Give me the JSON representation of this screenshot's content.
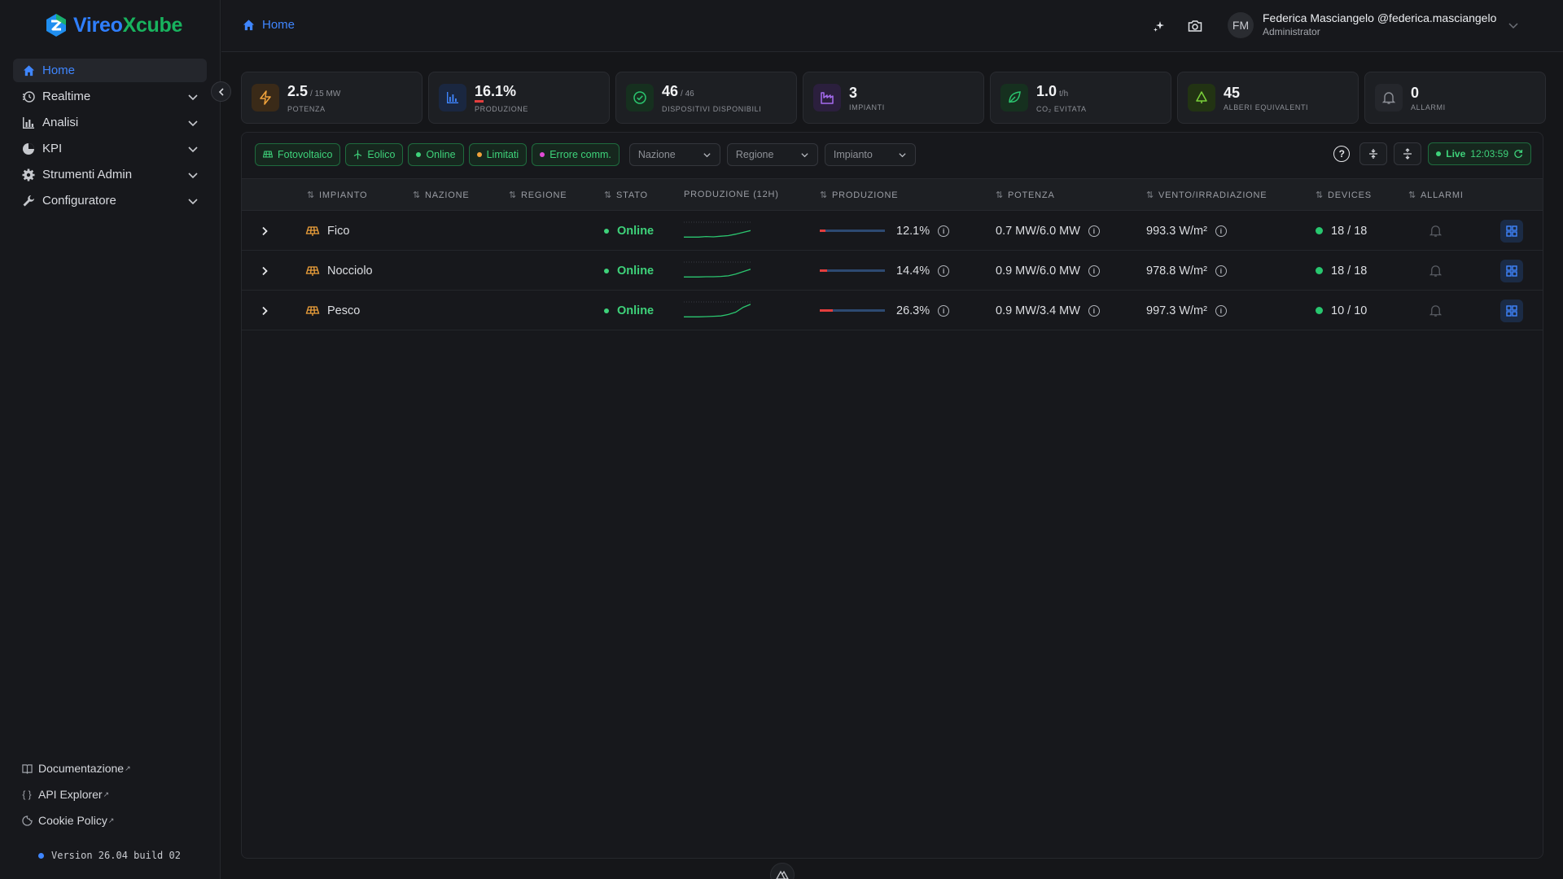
{
  "brand": {
    "part1": "Vireo",
    "part2": "Xcube"
  },
  "sidebar": {
    "items": [
      {
        "label": "Home",
        "icon": "home-icon",
        "active": true
      },
      {
        "label": "Realtime",
        "icon": "clock-icon"
      },
      {
        "label": "Analisi",
        "icon": "bar-chart-icon"
      },
      {
        "label": "KPI",
        "icon": "pie-chart-icon"
      },
      {
        "label": "Strumenti Admin",
        "icon": "gear-icon"
      },
      {
        "label": "Configuratore",
        "icon": "wrench-icon"
      }
    ],
    "links": [
      {
        "label": "Documentazione",
        "icon": "book-icon"
      },
      {
        "label": "API Explorer",
        "icon": "braces-icon"
      },
      {
        "label": "Cookie Policy",
        "icon": "cookie-icon"
      }
    ],
    "version": "Version 26.04 build 02"
  },
  "header": {
    "breadcrumb": "Home",
    "user": {
      "initials": "FM",
      "name": "Federica Masciangelo @federica.masciangelo",
      "role": "Administrator"
    }
  },
  "stats": [
    {
      "value": "2.5",
      "unit": "/ 15 MW",
      "label": "Potenza",
      "icon": "bolt-icon",
      "color": "#f0a23b"
    },
    {
      "value": "16.1%",
      "unit": "",
      "label": "Produzione",
      "icon": "bar-chart-icon",
      "color": "#3f86ff"
    },
    {
      "value": "46",
      "unit": "/ 46",
      "label": "Dispositivi disponibili",
      "icon": "check-circle-icon",
      "color": "#2bc56f"
    },
    {
      "value": "3",
      "unit": "",
      "label": "Impianti",
      "icon": "factory-icon",
      "color": "#a66cf0"
    },
    {
      "value": "1.0",
      "unit": "t/h",
      "label": "CO₂ evitata",
      "icon": "leaf-icon",
      "color": "#2bc56f"
    },
    {
      "value": "45",
      "unit": "",
      "label": "Alberi equivalenti",
      "icon": "tree-icon",
      "color": "#7bd23a"
    },
    {
      "value": "0",
      "unit": "",
      "label": "Allarmi",
      "icon": "bell-icon",
      "color": "#8d9097"
    }
  ],
  "filters": {
    "chips": [
      {
        "label": "Fotovoltaico",
        "icon": "solar-panel-icon"
      },
      {
        "label": "Eolico",
        "icon": "wind-turbine-icon"
      },
      {
        "label": "Online",
        "dot": "#3ed27a"
      },
      {
        "label": "Limitati",
        "dot": "#f0a23b"
      },
      {
        "label": "Errore comm.",
        "dot": "#e24bd6"
      }
    ],
    "selects": [
      {
        "placeholder": "Nazione"
      },
      {
        "placeholder": "Regione"
      },
      {
        "placeholder": "Impianto"
      }
    ],
    "live_label": "Live",
    "live_time": "12:03:59"
  },
  "table": {
    "columns": [
      "Impianto",
      "Nazione",
      "Regione",
      "Stato",
      "Produzione (12h)",
      "Produzione",
      "Potenza",
      "Vento/Irradiazione",
      "Devices",
      "Allarmi"
    ],
    "rows": [
      {
        "name": "Fico",
        "nazione": "",
        "regione": "",
        "stato": "Online",
        "produzione": "12.1%",
        "produzione_value": 0.121,
        "spark": [
          1,
          1,
          1,
          1.2,
          1.1,
          1.3,
          1.5,
          2,
          2.6,
          3.2
        ],
        "potenza": "0.7 MW/6.0 MW",
        "vento": "993.3 W/m²",
        "devices": "18 / 18"
      },
      {
        "name": "Nocciolo",
        "nazione": "",
        "regione": "",
        "stato": "Online",
        "produzione": "14.4%",
        "produzione_value": 0.144,
        "spark": [
          1,
          1,
          1,
          1.1,
          1.1,
          1.2,
          1.4,
          2,
          2.8,
          3.6
        ],
        "potenza": "0.9 MW/6.0 MW",
        "vento": "978.8 W/m²",
        "devices": "18 / 18"
      },
      {
        "name": "Pesco",
        "nazione": "",
        "regione": "",
        "stato": "Online",
        "produzione": "26.3%",
        "produzione_value": 0.263,
        "spark": [
          1,
          1,
          1,
          1.1,
          1.2,
          1.3,
          1.8,
          2.6,
          4.2,
          5.2
        ],
        "potenza": "0.9 MW/3.4 MW",
        "vento": "997.3 W/m²",
        "devices": "10 / 10"
      }
    ]
  },
  "colors": {
    "accent": "#3f86ff",
    "online": "#3ed27a",
    "alert": "#e33e3e",
    "brand_green": "#18b35e"
  }
}
